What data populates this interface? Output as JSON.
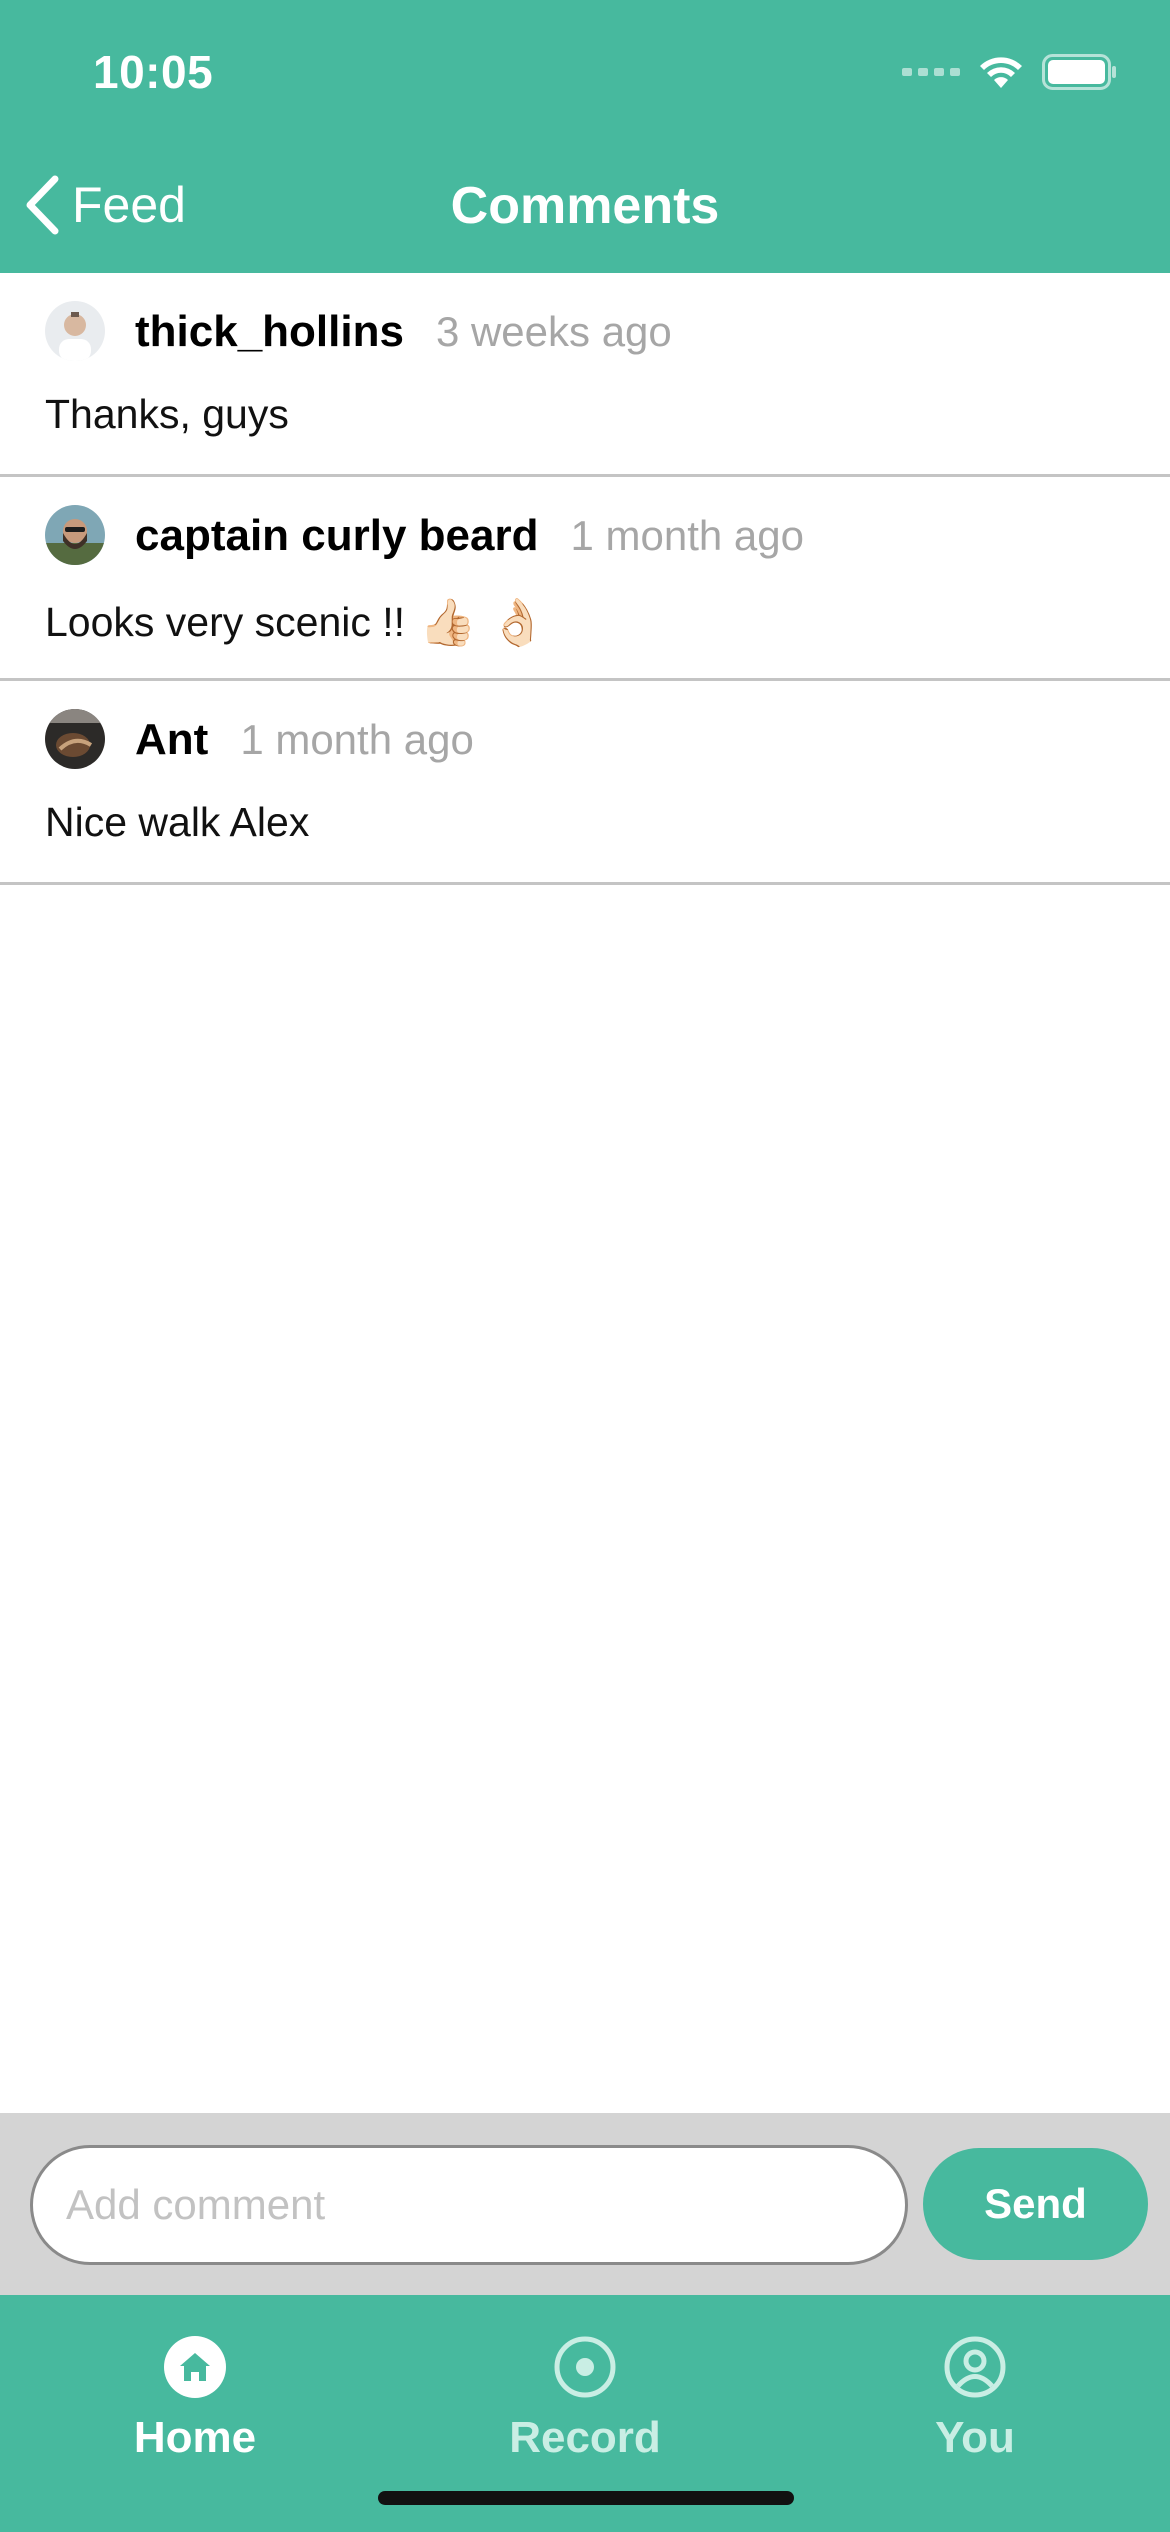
{
  "status_bar": {
    "time": "10:05"
  },
  "nav": {
    "back_label": "Feed",
    "title": "Comments"
  },
  "comments": [
    {
      "author": "thick_hollins",
      "time": "3 weeks ago",
      "text": "Thanks, guys",
      "emoji": ""
    },
    {
      "author": "captain curly beard",
      "time": "1 month ago",
      "text": "Looks very scenic !!",
      "emoji": "👍🏻 👌🏻"
    },
    {
      "author": "Ant",
      "time": "1 month ago",
      "text": "Nice walk Alex",
      "emoji": ""
    }
  ],
  "compose": {
    "placeholder": "Add comment",
    "value": "",
    "send_label": "Send"
  },
  "tabs": [
    {
      "label": "Home",
      "icon": "home-icon",
      "active": true
    },
    {
      "label": "Record",
      "icon": "record-icon",
      "active": false
    },
    {
      "label": "You",
      "icon": "profile-icon",
      "active": false
    }
  ],
  "colors": {
    "brand": "#47b99e",
    "separator": "#c4c4c4",
    "meta_text": "#a6a6a6",
    "compose_bg": "#d4d4d4"
  }
}
